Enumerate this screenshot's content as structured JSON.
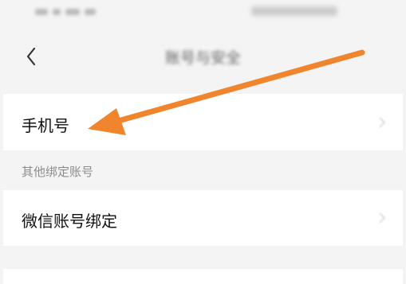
{
  "status_bar": {},
  "nav": {
    "back_icon": "chevron-left-icon",
    "title": "账号与安全"
  },
  "rows": {
    "phone": {
      "label": "手机号",
      "value": ""
    },
    "wechat": {
      "label": "微信账号绑定"
    }
  },
  "sections": {
    "other_bindings": "其他绑定账号"
  },
  "annotation": {
    "arrow_color": "#f0852d"
  },
  "colors": {
    "background": "#f4f4f5",
    "card": "#ffffff"
  }
}
